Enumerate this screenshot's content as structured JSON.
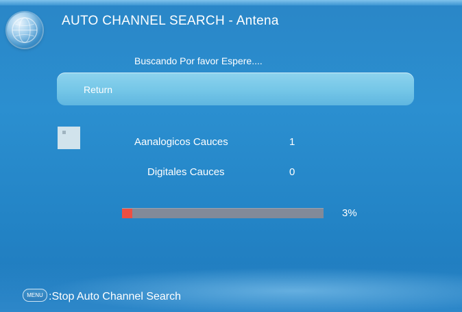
{
  "header": {
    "title": "AUTO CHANNEL SEARCH - Antena",
    "logo_icon": "globe-logo-icon"
  },
  "status": {
    "message": "Buscando Por favor Espere...."
  },
  "return_button": {
    "label": "Return"
  },
  "channels": [
    {
      "label": "Aanalogicos Cauces",
      "value": "1"
    },
    {
      "label": "Digitales Cauces",
      "value": "0"
    }
  ],
  "progress": {
    "percent": 3,
    "label": "3%"
  },
  "footer": {
    "key_label": "MENU",
    "hint": ":Stop Auto Channel Search"
  },
  "colors": {
    "background": "#2a86c7",
    "button": "#7ccbea",
    "progress_track": "#828a99",
    "progress_fill": "#ee4f42",
    "text": "#ffffff"
  }
}
